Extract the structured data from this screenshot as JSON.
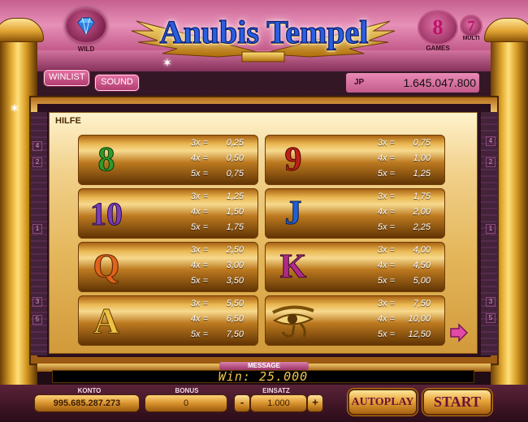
{
  "header": {
    "title": "Anubis Tempel",
    "wild_label": "WILD",
    "games_value": "8",
    "games_label": "GAMES",
    "multi_value": "7",
    "multi_label": "MULTI"
  },
  "toolbar": {
    "winlist_label": "WINLIST",
    "sound_label": "SOUND"
  },
  "jackpot": {
    "label": "JP",
    "value": "1.645.047.800"
  },
  "help": {
    "title": "HILFE",
    "paytable": [
      {
        "symbol": "8",
        "symbol_color": "#2f9a2c",
        "rows": [
          [
            "3x =",
            "0,25"
          ],
          [
            "4x =",
            "0,50"
          ],
          [
            "5x =",
            "0,75"
          ]
        ]
      },
      {
        "symbol": "9",
        "symbol_color": "#c02018",
        "rows": [
          [
            "3x =",
            "0,75"
          ],
          [
            "4x =",
            "1,00"
          ],
          [
            "5x =",
            "1,25"
          ]
        ]
      },
      {
        "symbol": "10",
        "symbol_color": "#7a3fb8",
        "rows": [
          [
            "3x =",
            "1,25"
          ],
          [
            "4x =",
            "1,50"
          ],
          [
            "5x =",
            "1,75"
          ]
        ]
      },
      {
        "symbol": "J",
        "symbol_color": "#1f5fd8",
        "rows": [
          [
            "3x =",
            "1,75"
          ],
          [
            "4x =",
            "2,00"
          ],
          [
            "5x =",
            "2,25"
          ]
        ]
      },
      {
        "symbol": "Q",
        "symbol_color": "#e0641c",
        "rows": [
          [
            "3x =",
            "2,50"
          ],
          [
            "4x =",
            "3,00"
          ],
          [
            "5x =",
            "3,50"
          ]
        ]
      },
      {
        "symbol": "K",
        "symbol_color": "#b02a88",
        "rows": [
          [
            "3x =",
            "4,00"
          ],
          [
            "4x =",
            "4,50"
          ],
          [
            "5x =",
            "5,00"
          ]
        ]
      },
      {
        "symbol": "A",
        "symbol_color": "#e8b83a",
        "rows": [
          [
            "3x =",
            "5,50"
          ],
          [
            "4x =",
            "6,50"
          ],
          [
            "5x =",
            "7,50"
          ]
        ]
      },
      {
        "symbol": "",
        "symbol_icon": "eye-of-horus-icon",
        "rows": [
          [
            "3x =",
            "7,50"
          ],
          [
            "4x =",
            "10,00"
          ],
          [
            "5x =",
            "12,50"
          ]
        ]
      }
    ],
    "line_numbers_left": [
      "4",
      "2",
      "1",
      "3",
      "5"
    ],
    "line_numbers_right": [
      "4",
      "2",
      "1",
      "3",
      "5"
    ]
  },
  "message": {
    "label": "MESSAGE",
    "text": "Win: 25.000"
  },
  "controls": {
    "konto_label": "KONTO",
    "konto_value": "995.685.287.273",
    "bonus_label": "BONUS",
    "bonus_value": "0",
    "einsatz_label": "EINSATZ",
    "einsatz_value": "1.000",
    "minus_label": "-",
    "plus_label": "+",
    "autoplay_label": "AUTOPLAY",
    "start_label": "START"
  },
  "colors": {
    "header_pink": "#e790b8",
    "gold": "#e6a53a",
    "button_text": "#6b1234",
    "message_text": "#f1c44d"
  }
}
